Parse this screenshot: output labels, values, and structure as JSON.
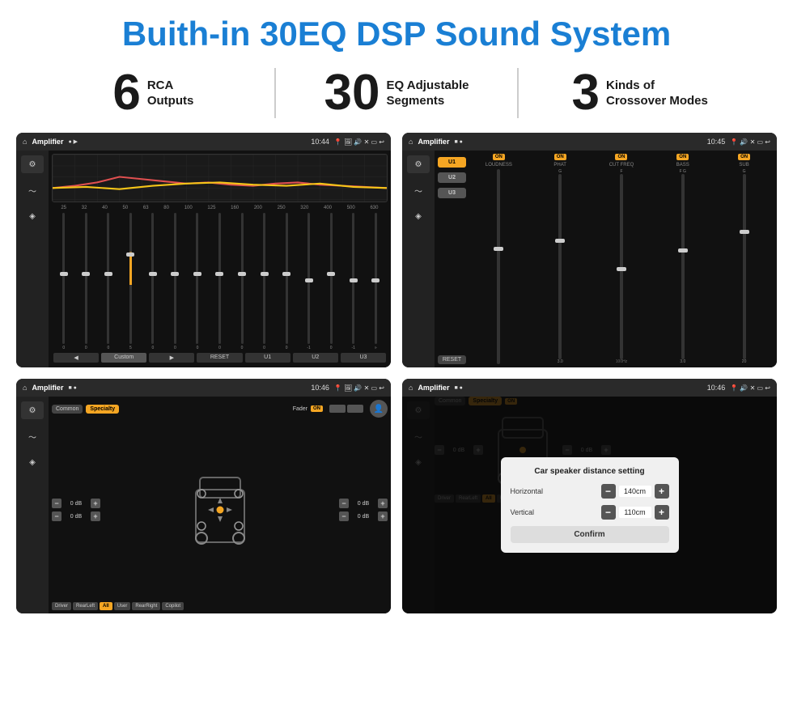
{
  "header": {
    "title": "Buith-in 30EQ DSP Sound System"
  },
  "stats": [
    {
      "number": "6",
      "label": "RCA\nOutputs"
    },
    {
      "number": "30",
      "label": "EQ Adjustable\nSegments"
    },
    {
      "number": "3",
      "label": "Kinds of\nCrossover Modes"
    }
  ],
  "screens": {
    "eq": {
      "title": "Amplifier",
      "time": "10:44",
      "frequencies": [
        "25",
        "32",
        "40",
        "50",
        "63",
        "80",
        "100",
        "125",
        "160",
        "200",
        "250",
        "320",
        "400",
        "500",
        "630"
      ],
      "values": [
        "0",
        "0",
        "0",
        "5",
        "0",
        "0",
        "0",
        "0",
        "0",
        "0",
        "0",
        "-1",
        "0",
        "-1"
      ],
      "presets": [
        "Custom",
        "RESET",
        "U1",
        "U2",
        "U3"
      ]
    },
    "crossover": {
      "title": "Amplifier",
      "time": "10:45",
      "presets": [
        "U1",
        "U2",
        "U3"
      ],
      "channels": [
        "LOUDNESS",
        "PHAT",
        "CUT FREQ",
        "BASS",
        "SUB"
      ]
    },
    "speaker": {
      "title": "Amplifier",
      "time": "10:46",
      "tabs": [
        "Common",
        "Specialty"
      ],
      "fader_label": "Fader",
      "buttons": [
        "Driver",
        "RearLeft",
        "All",
        "User",
        "RearRight",
        "Copilot"
      ],
      "db_values": [
        "0 dB",
        "0 dB",
        "0 dB",
        "0 dB"
      ]
    },
    "distance": {
      "title": "Amplifier",
      "time": "10:46",
      "dialog": {
        "title": "Car speaker distance setting",
        "horizontal_label": "Horizontal",
        "horizontal_value": "140cm",
        "vertical_label": "Vertical",
        "vertical_value": "110cm",
        "confirm_label": "Confirm"
      }
    }
  }
}
